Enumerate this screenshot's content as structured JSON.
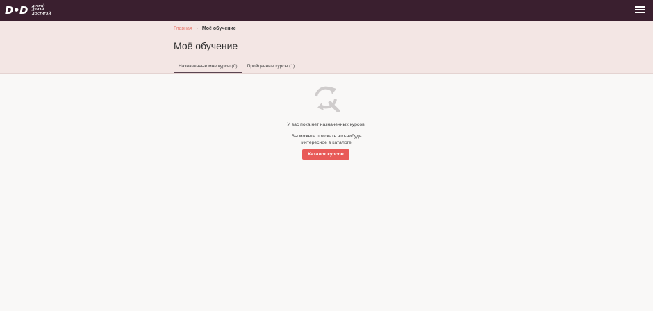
{
  "header": {
    "logo_mark": "D•D",
    "logo_lines": [
      "ДУМАЙ",
      "ДЕЛАЙ",
      "ДОСТИГАЙ"
    ],
    "menu_icon": "hamburger-icon"
  },
  "breadcrumb": {
    "home": "Главная",
    "separator": "›",
    "current": "Моё обучение"
  },
  "page_title": "Моё обучение",
  "tabs": [
    {
      "label": "Назначенные мне курсы (0)",
      "active": true
    },
    {
      "label": "Пройденные курсы (1)",
      "active": false
    }
  ],
  "empty_state": {
    "icon": "refresh-search-icon",
    "message": "У вас пока нет назначенных курсов.",
    "subtext": "Вы можете поискать что-нибудь интересное в каталоге",
    "button_label": "Каталог курсов"
  },
  "colors": {
    "topbar": "#3a1f2f",
    "hero": "#f3e6e4",
    "accent": "#e85a58",
    "link": "#e87c70"
  }
}
